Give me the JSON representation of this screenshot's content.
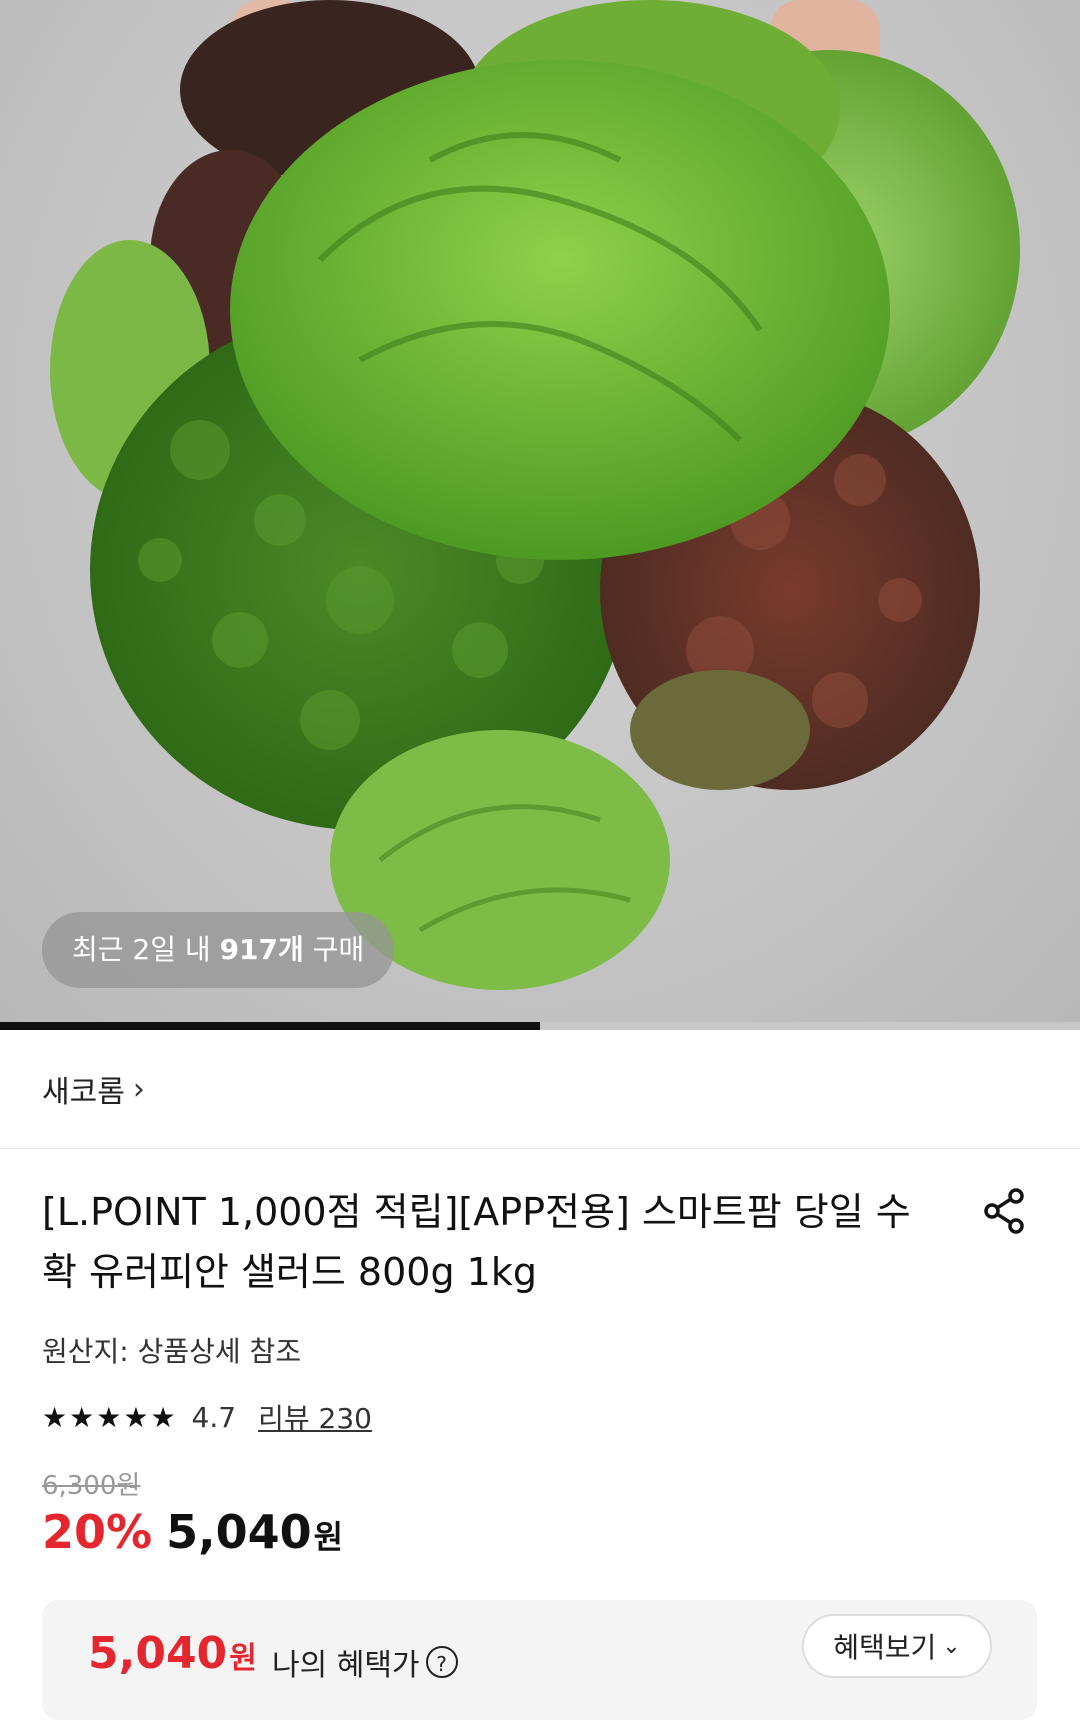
{
  "hero": {
    "image_subject": "salad-greens-photo",
    "buy_badge": {
      "prefix": "최근 2일 내 ",
      "count": "917개",
      "suffix": " 구매"
    },
    "gallery_progress": 0.5
  },
  "brand": {
    "name": "새코롬",
    "chevron": "›"
  },
  "product": {
    "title": "[L.POINT 1,000점 적립][APP전용] 스마트팜 당일 수확 유러피안 샐러드 800g 1kg",
    "share_icon": "share-icon",
    "origin": "원산지: 상품상세 참조",
    "rating": {
      "stars": [
        "★",
        "★",
        "★",
        "★",
        "★"
      ],
      "value": "4.7",
      "review_label": "리뷰 230"
    },
    "price": {
      "original": "6,300원",
      "discount": "20%",
      "sale": "5,040",
      "currency": "원"
    }
  },
  "benefit": {
    "price": "5,040",
    "currency": "원",
    "label": "나의 혜택가",
    "help": "?",
    "button": "혜택보기",
    "button_chevron": "⌄"
  },
  "colors": {
    "accent": "#e4262f",
    "text": "#111111"
  }
}
